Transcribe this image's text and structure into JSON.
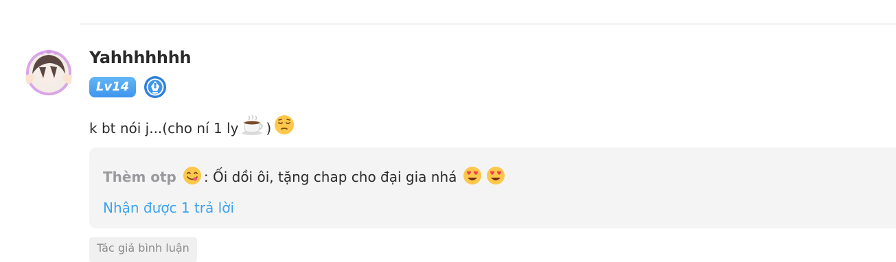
{
  "comment": {
    "username": "Yahhhhhhh",
    "level": "Lv14",
    "text_prefix": "k bt nói j...(cho ní 1 ly",
    "text_suffix": " )",
    "icons": [
      "coffee-emoji",
      "pensive-emoji"
    ]
  },
  "reply": {
    "author": "Thèm otp",
    "author_emoji": "yum-emoji",
    "text": ": Ối dồi ôi, tặng chap cho đại gia nhá",
    "end_emojis": [
      "heart-eyes-emoji",
      "heart-eyes-emoji"
    ],
    "count_label": "Nhận được 1 trả lời"
  },
  "author_tag": "Tác giả bình luận",
  "colors": {
    "level_badge": "#4aa2f0",
    "reply_link": "#3aa3ee",
    "reply_bg": "#f4f4f5"
  }
}
